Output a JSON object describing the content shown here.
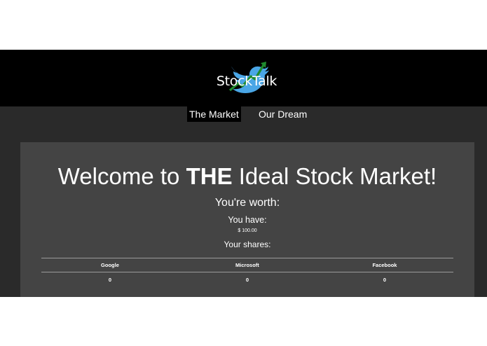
{
  "brand": {
    "name": "StockTalk",
    "icon": "twitter-bird-with-stock-arrow-icon",
    "bird_color": "#4aa6e6",
    "line_color": "#1f8a2e"
  },
  "nav": {
    "items": [
      {
        "label": "The Market",
        "active": true
      },
      {
        "label": "Our Dream",
        "active": false
      }
    ]
  },
  "main": {
    "welcome_prefix": "Welcome to ",
    "welcome_emphasis": "THE",
    "welcome_suffix": " Ideal Stock Market!",
    "worth_label": "You're worth:",
    "have_label": "You have:",
    "have_value": "$ 100.00",
    "shares_label": "Your shares:"
  },
  "shares": {
    "columns": [
      "Google",
      "Microsoft",
      "Facebook"
    ],
    "values": [
      "0",
      "0",
      "0"
    ]
  },
  "colors": {
    "header_bg": "#000000",
    "page_bg": "#2a2a2a",
    "panel_bg": "#444444",
    "text": "#ffffff"
  }
}
